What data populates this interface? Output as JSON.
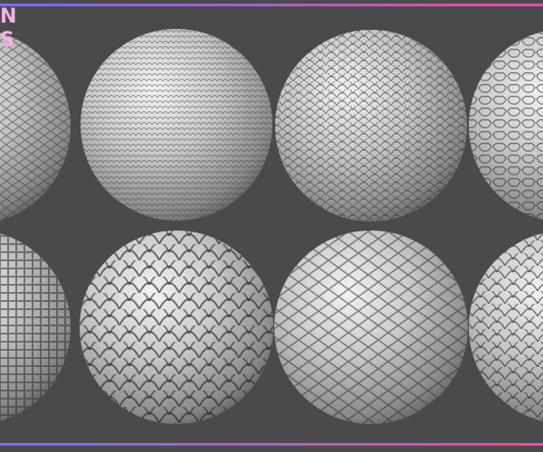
{
  "logo": {
    "line1": "N",
    "line2": "S"
  },
  "colors": {
    "background": "#4a4a4d",
    "bar_left": "#7b6cf6",
    "bar_right": "#ef4aa8",
    "logo_text": "#f3b3e2",
    "sphere_base": "#c9c9c9"
  },
  "spheres": [
    {
      "pattern": "snake-scales-diamond",
      "row": 1,
      "col": 1
    },
    {
      "pattern": "fine-horizontal-scales",
      "row": 1,
      "col": 2
    },
    {
      "pattern": "small-round-scales",
      "row": 1,
      "col": 3
    },
    {
      "pattern": "irregular-bumpy-scales",
      "row": 1,
      "col": 4
    },
    {
      "pattern": "grid-scales",
      "row": 2,
      "col": 1
    },
    {
      "pattern": "fish-scales-raised",
      "row": 2,
      "col": 2
    },
    {
      "pattern": "diamond-scales-large",
      "row": 2,
      "col": 3
    },
    {
      "pattern": "fish-scales-overlapping",
      "row": 2,
      "col": 4
    }
  ]
}
